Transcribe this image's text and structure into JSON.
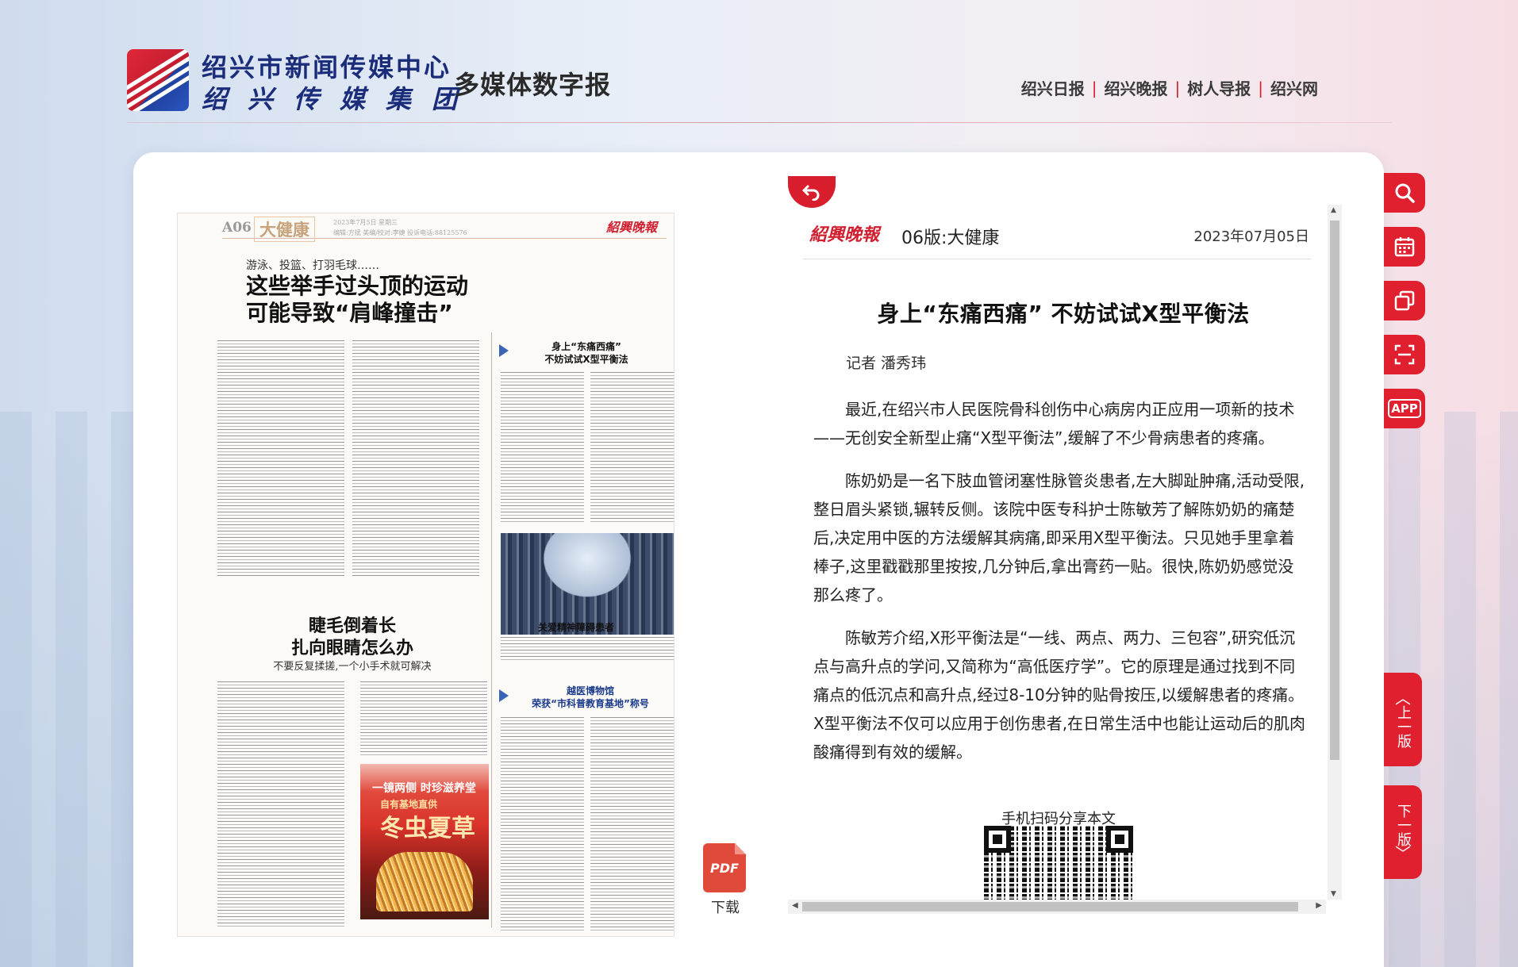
{
  "header": {
    "org_name": "绍兴市新闻传媒中心",
    "org_group": "绍兴传媒集团",
    "site_title": "多媒体数字报",
    "links": [
      "绍兴日报",
      "绍兴晚报",
      "树人导报",
      "绍兴网"
    ],
    "separator": "|"
  },
  "newspaper": {
    "page_num": "A06",
    "section": "大健康",
    "meta": "2023年7月5日  星期三",
    "meta2": "编辑:方斌  美编/校对:李婕  投诉电话:88125576",
    "brand": "紹興晚報",
    "kicker": "游泳、投篮、打羽毛球……",
    "headline_1": "这些举手过头顶的运动",
    "headline_2": "可能导致“肩峰撞击”",
    "headline2_1": "睫毛倒着长",
    "headline2_2": "扎向眼睛怎么办",
    "headline2_sub": "不要反复揉搓,一个小手术就可解决",
    "side_story_1": "身上“东痛西痛”",
    "side_story_2": "不妨试试X型平衡法",
    "side_story2_1": "越医博物馆",
    "side_story2_2": "荣获“市科普教育基地”称号",
    "photo_title": "关爱精神障碍患者",
    "ad_title": "一镜两侧 时珍滋养堂",
    "ad_sub": "自有基地直供",
    "ad_big": "冬虫夏草"
  },
  "download": {
    "icon_label": "PDF",
    "label": "下载"
  },
  "article": {
    "brand": "紹興晚報",
    "edition": "06版:大健康",
    "date": "2023年07月05日",
    "title": "身上“东痛西痛” 不妨试试X型平衡法",
    "author": "记者 潘秀玮",
    "paragraphs": [
      "最近,在绍兴市人民医院骨科创伤中心病房内正应用一项新的技术——无创安全新型止痛“X型平衡法”,缓解了不少骨病患者的疼痛。",
      "陈奶奶是一名下肢血管闭塞性脉管炎患者,左大脚趾肿痛,活动受限,整日眉头紧锁,辗转反侧。该院中医专科护士陈敏芳了解陈奶奶的痛楚后,决定用中医的方法缓解其病痛,即采用X型平衡法。只见她手里拿着棒子,这里戳戳那里按按,几分钟后,拿出膏药一贴。很快,陈奶奶感觉没那么疼了。",
      "陈敏芳介绍,X形平衡法是“一线、两点、两力、三包容”,研究低沉点与高升点的学问,又简称为“高低医疗学”。它的原理是通过找到不同痛点的低沉点和高升点,经过8-10分钟的贴骨按压,以缓解患者的疼痛。X型平衡法不仅可以应用于创伤患者,在日常生活中也能让运动后的肌肉酸痛得到有效的缓解。"
    ],
    "qr_label": "手机扫码分享本文"
  },
  "tools": {
    "icons": [
      "search-icon",
      "calendar-icon",
      "copy-icon",
      "scan-icon",
      "app-icon"
    ],
    "app_label": "APP",
    "prev_page": "上一版",
    "next_page": "下一版"
  },
  "colors": {
    "brand_red": "#e0202e",
    "title_blue": "#1a2c7a"
  }
}
